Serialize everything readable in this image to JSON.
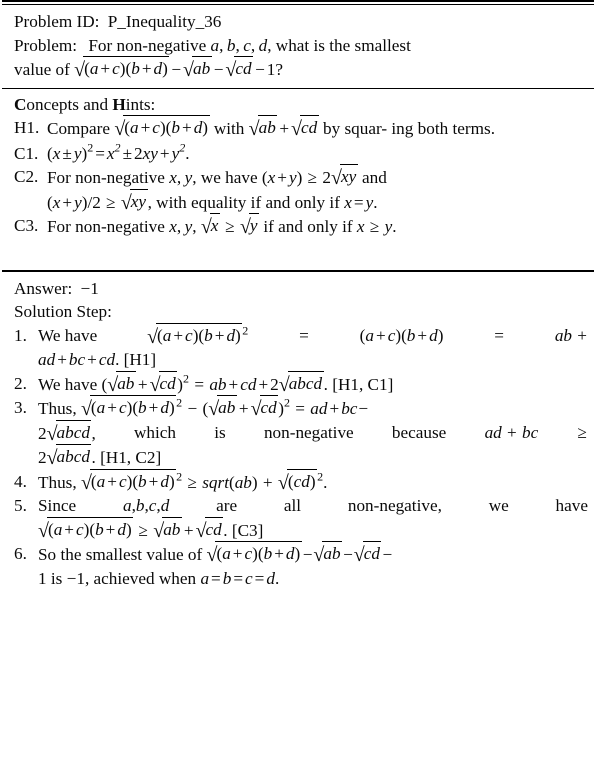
{
  "document": {
    "type": "latex-table-figure",
    "background": "#ffffff",
    "text_color": "#0a0a0a"
  },
  "problem_block": {
    "id_label": "Problem ID:",
    "id_value": "P_Inequality_36",
    "problem_label": "Problem:",
    "problem_text_line1": "For non-negative a, b, c, d, what is the smallest",
    "problem_text_line2": "value of √((a+c)(b+d)) − √(ab) − √(cd) − 1?",
    "full_problem": "For non-negative a, b, c, d, what is the smallest value of √((a+c)(b+d)) − √ab − √cd − 1?"
  },
  "concepts_block": {
    "heading": "Concepts and Hints:",
    "heading_bold_chars": [
      "C",
      "H"
    ],
    "items": [
      {
        "label": "H1.",
        "line1": "Compare √((a+c)(b+d)) with √ab + √cd by squar-",
        "line2": "ing both terms.",
        "text": "Compare √((a+c)(b+d)) with √ab + √cd by squaring both terms."
      },
      {
        "label": "C1.",
        "line1": "(x ± y)² = x² ± 2xy + y².",
        "text": "(x ± y)^2 = x^2 ± 2xy + y^2."
      },
      {
        "label": "C2.",
        "line1": "For non-negative x, y, we have (x + y) ≥ 2√xy and",
        "line2": "(x + y)/2 ≥ √xy, with equality if and only if x = y.",
        "text": "For non-negative x, y, we have (x + y) ≥ 2√xy and (x + y)/2 ≥ √xy, with equality if and only if x = y."
      },
      {
        "label": "C3.",
        "line1": "For non-negative x, y, √x ≥ √y if and only if x ≥ y.",
        "text": "For non-negative x, y, √x ≥ √y if and only if x ≥ y."
      }
    ]
  },
  "answer_block": {
    "answer_label": "Answer:",
    "answer_value": "−1",
    "solution_heading": "Solution Step:",
    "steps": [
      {
        "label": "1.",
        "text": "We have √((a+c)(b+d))² = (a+c)(b+d) = ab + ad + bc + cd. [H1]",
        "citation": "[H1]"
      },
      {
        "label": "2.",
        "text": "We have (√ab + √cd)² = ab + cd + 2√abcd. [H1, C1]",
        "citation": "[H1, C1]"
      },
      {
        "label": "3.",
        "text": "Thus, √((a+c)(b+d))² − (√ab + √cd)² = ad + bc − 2√abcd, which is non-negative because ad + bc ≥ 2√abcd. [H1, C2]",
        "citation": "[H1, C2]"
      },
      {
        "label": "4.",
        "text": "Thus, √((a+c)(b+d))² ≥ sqrt(ab) + √(cd)².",
        "citation": ""
      },
      {
        "label": "5.",
        "text": "Since a, b, c, d are all non-negative, we have √((a+c)(b+d)) ≥ √ab + √cd. [C3]",
        "citation": "[C3]"
      },
      {
        "label": "6.",
        "text": "So the smallest value of √((a+c)(b+d)) − √ab − √cd − 1 is −1, achieved when a = b = c = d.",
        "citation": ""
      }
    ]
  },
  "glyphs": {
    "radical": "√",
    "minus": "−",
    "plusminus": "±",
    "geq": "≥",
    "plus": "+",
    "equals": "="
  }
}
